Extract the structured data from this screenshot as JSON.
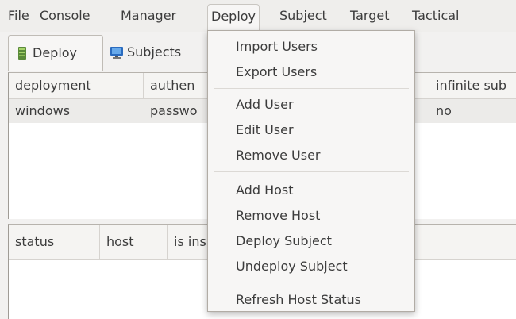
{
  "menubar": {
    "file": "File",
    "console": "Console",
    "manager": "Manager",
    "deploy": "Deploy",
    "subject": "Subject",
    "target": "Target",
    "tactical": "Tactical"
  },
  "tabs": {
    "deploy": "Deploy",
    "subjects": "Subjects"
  },
  "deploy_table": {
    "headers": {
      "deployment": "deployment",
      "authen": "authen",
      "infinite": "infinite sub"
    },
    "row": {
      "deployment": "windows",
      "authen": "passwo",
      "infinite": "no"
    }
  },
  "status_table": {
    "headers": {
      "status": "status",
      "host": "host",
      "is_installed": "is ins"
    }
  },
  "deploy_menu": {
    "import_users": "Import Users",
    "export_users": "Export Users",
    "add_user": "Add User",
    "edit_user": "Edit User",
    "remove_user": "Remove User",
    "add_host": "Add Host",
    "remove_host": "Remove Host",
    "deploy_subject": "Deploy Subject",
    "undeploy_subject": "Undeploy Subject",
    "refresh_host_status": "Refresh Host Status"
  },
  "icons": {
    "deploy_tab": "server-icon",
    "subjects_tab": "monitor-icon"
  },
  "colors": {
    "selected_row": "#ecebe9",
    "menu_bg": "#f7f6f5"
  }
}
